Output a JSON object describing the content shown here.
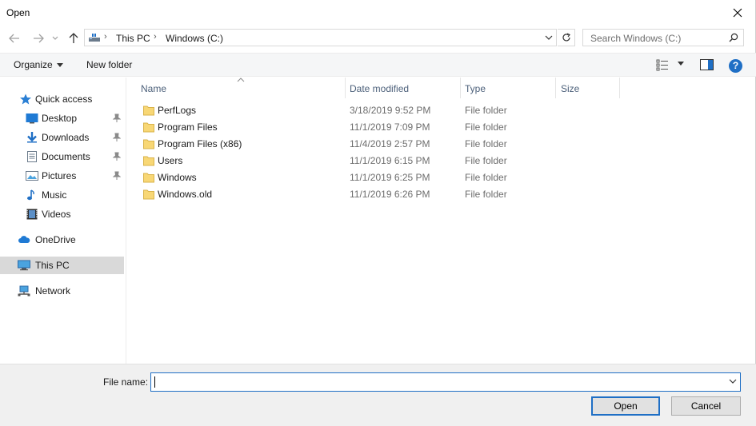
{
  "window": {
    "title": "Open"
  },
  "address": {
    "crumbs": [
      "This PC",
      "Windows (C:)"
    ]
  },
  "search": {
    "placeholder": "Search Windows (C:)"
  },
  "toolbar": {
    "organize_label": "Organize",
    "new_folder_label": "New folder",
    "help_label": "?"
  },
  "nav": {
    "items": [
      {
        "label": "Quick access",
        "icon": "star-icon"
      },
      {
        "label": "Desktop",
        "icon": "desktop-icon",
        "pinned": true
      },
      {
        "label": "Downloads",
        "icon": "download-icon",
        "pinned": true
      },
      {
        "label": "Documents",
        "icon": "document-icon",
        "pinned": true
      },
      {
        "label": "Pictures",
        "icon": "pictures-icon",
        "pinned": true
      },
      {
        "label": "Music",
        "icon": "music-icon"
      },
      {
        "label": "Videos",
        "icon": "video-icon"
      },
      {
        "label": "OneDrive",
        "icon": "cloud-icon"
      },
      {
        "label": "This PC",
        "icon": "computer-icon",
        "selected": true
      },
      {
        "label": "Network",
        "icon": "network-icon"
      }
    ]
  },
  "columns": {
    "name": "Name",
    "date": "Date modified",
    "type": "Type",
    "size": "Size"
  },
  "files": [
    {
      "name": "PerfLogs",
      "date": "3/18/2019 9:52 PM",
      "type": "File folder"
    },
    {
      "name": "Program Files",
      "date": "11/1/2019 7:09 PM",
      "type": "File folder"
    },
    {
      "name": "Program Files (x86)",
      "date": "11/4/2019 2:57 PM",
      "type": "File folder"
    },
    {
      "name": "Users",
      "date": "11/1/2019 6:15 PM",
      "type": "File folder"
    },
    {
      "name": "Windows",
      "date": "11/1/2019 6:25 PM",
      "type": "File folder"
    },
    {
      "name": "Windows.old",
      "date": "11/1/2019 6:26 PM",
      "type": "File folder"
    }
  ],
  "filename": {
    "label": "File name:",
    "value": ""
  },
  "buttons": {
    "open_label": "Open",
    "cancel_label": "Cancel"
  },
  "colors": {
    "accent": "#1f6fc5",
    "folder": "#f8d775",
    "selected_bg": "#d9d9d9"
  }
}
